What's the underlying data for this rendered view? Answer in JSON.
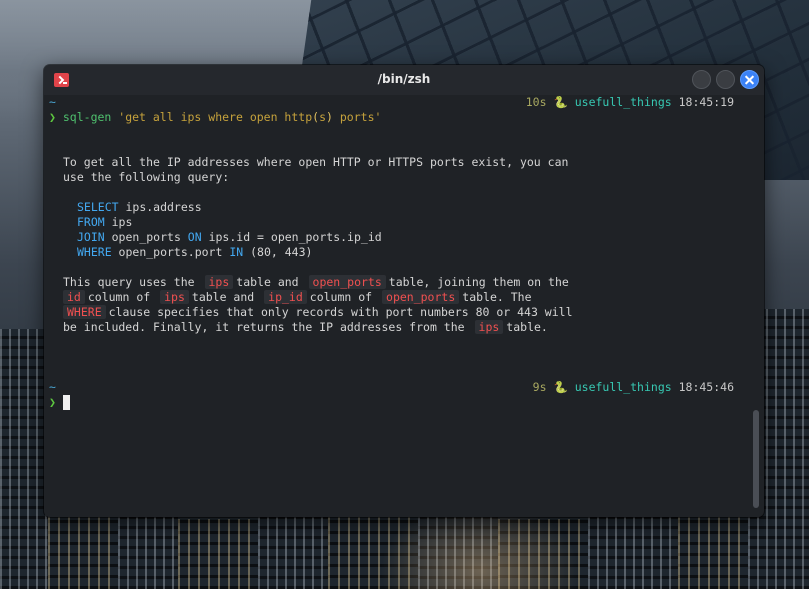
{
  "window": {
    "title": "/bin/zsh"
  },
  "prompt1": {
    "dir": "~",
    "arrow": "❯",
    "command_name": "sql-gen",
    "command_arg_1": " 'get all ips where open http",
    "command_arg_paren_open": "(",
    "command_arg_s": "s",
    "command_arg_paren_close": ")",
    "command_arg_2": " ports'",
    "duration": "10s",
    "snake_icon": "🐍",
    "env": "usefull_things",
    "time": "18:45:19"
  },
  "output": {
    "intro_line1": "To get all the IP addresses where open HTTP or HTTPS ports exist, you can",
    "intro_line2": "use the following query:",
    "sql": [
      {
        "kw": "SELECT",
        "rest": " ips.address"
      },
      {
        "kw": "FROM",
        "rest": " ips"
      },
      {
        "kw": "JOIN",
        "rest": " open_ports ",
        "kw2": "ON",
        "rest2": " ips.id = open_ports.ip_id"
      },
      {
        "kw": "WHERE",
        "rest": " open_ports.port ",
        "kw2": "IN",
        "rest2": " (80, 443)"
      }
    ],
    "explain": {
      "l1_a": "This query uses the",
      "code_ips": "ips",
      "l1_b": "table and",
      "code_open_ports": "open_ports",
      "l1_c": "table, joining them on the",
      "code_id": "id",
      "l2_a": "column of",
      "l2_b": "table and",
      "code_ip_id": "ip_id",
      "l2_c": "column of",
      "l2_d": "table. The",
      "code_where": "WHERE",
      "l3_a": "clause specifies that only records with port numbers 80 or 443 will",
      "l4_a": "be included. Finally, it returns the IP addresses from the",
      "l4_b": "table."
    }
  },
  "prompt2": {
    "dir": "~",
    "arrow": "❯",
    "duration": "9s",
    "snake_icon": "🐍",
    "env": "usefull_things",
    "time": "18:45:46"
  },
  "colors": {
    "tilde": "#4ba7d4",
    "arrow": "#5ec840",
    "keyword": "#43a8f0",
    "inline_code": "#f05050",
    "env": "#37c8b2",
    "close_button": "#3b82f6"
  }
}
